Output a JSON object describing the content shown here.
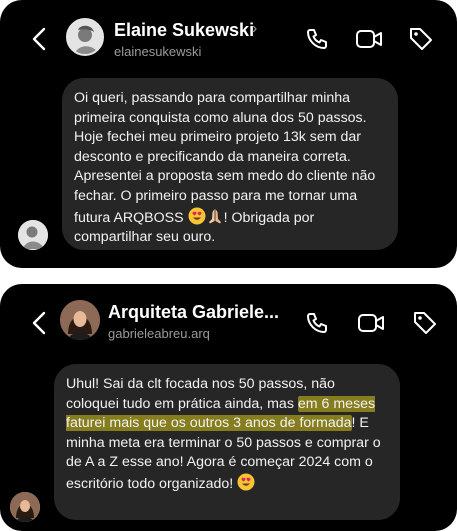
{
  "conversations": [
    {
      "contact": {
        "name": "Elaine Sukewski",
        "chevron": "›",
        "handle": "elainesukewski",
        "avatar_icon": "profile-photo-icon"
      },
      "header_icons": [
        "chevron-left-icon",
        "phone-icon",
        "video-icon",
        "tag-icon"
      ],
      "message": {
        "text_before_emoji": "Oi queri, passando para compartilhar minha primeira conquista como aluna dos 50 passos. Hoje fechei meu primeiro projeto 13k sem dar desconto e precificando da maneira correta. Apresentei a proposta sem medo do cliente não fechar. O primeiro passo para me tornar uma futura ARQBOSS ",
        "emojis": [
          "heart-eyes-emoji",
          "praying-hands-emoji"
        ],
        "text_after_emoji": "! Obrigada por compartilhar seu ouro."
      }
    },
    {
      "contact": {
        "name": "Arquiteta Gabriele...",
        "handle": "gabrieleabreu.arq",
        "avatar_icon": "profile-photo-icon"
      },
      "header_icons": [
        "chevron-left-icon",
        "phone-icon",
        "video-icon",
        "tag-icon"
      ],
      "message": {
        "text_part1": "Uhul! Sai da clt focada nos 50 passos, não coloquei tudo em prática ainda, mas ",
        "highlighted": "em 6 meses faturei mais que os outros 3 anos de formada",
        "text_part2": "! E minha meta era terminar o 50 passos e comprar o de A a Z esse ano! Agora é começar 2024 com o escritório todo organizado! ",
        "emojis": [
          "heart-eyes-emoji"
        ]
      }
    }
  ],
  "colors": {
    "background": "#000000",
    "bubble": "#262626",
    "text": "#f2f2f2",
    "secondary_text": "#9a9a9a",
    "highlight": "#d6c418"
  }
}
